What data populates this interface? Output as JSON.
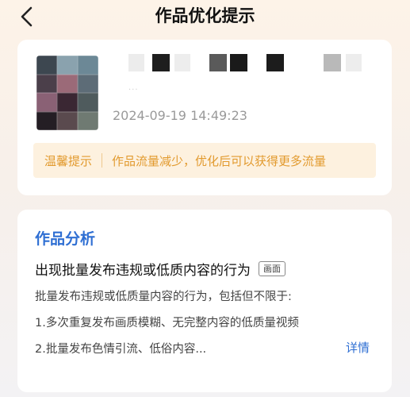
{
  "header": {
    "title": "作品优化提示",
    "back_icon": "chevron-left-icon"
  },
  "post": {
    "subtitle": "···",
    "timestamp": "2024-09-19 14:49:23"
  },
  "tip": {
    "label": "温馨提示",
    "text": "作品流量减少，优化后可以获得更多流量",
    "color": "#e29a2e",
    "background": "#fdf1df"
  },
  "analysis": {
    "section_title": "作品分析",
    "issue_title": "出现批量发布违规或低质内容的行为",
    "issue_tag": "画面",
    "description": "批量发布违规或低质量内容的行为，包括但不限于:",
    "items": [
      "1.多次重复发布画质模糊、无完整内容的低质量视频",
      "2.批量发布色情引流、低俗内容..."
    ],
    "detail_link": "详情",
    "accent_color": "#2f6fd3"
  }
}
